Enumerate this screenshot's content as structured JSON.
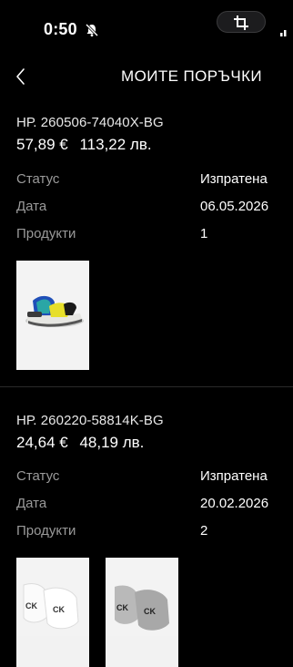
{
  "status_bar": {
    "time": "0:50"
  },
  "header": {
    "title": "МОИТЕ ПОРЪЧКИ"
  },
  "orders": [
    {
      "number": "НР. 260506-74040X-BG",
      "price_eur": "57,89 €",
      "price_bgn": "113,22 лв.",
      "status_label": "Статус",
      "status_value": "Изпратена",
      "date_label": "Дата",
      "date_value": "06.05.2026",
      "products_label": "Продукти",
      "products_value": "1"
    },
    {
      "number": "НР. 260220-58814K-BG",
      "price_eur": "24,64 €",
      "price_bgn": "48,19 лв.",
      "status_label": "Статус",
      "status_value": "Изпратена",
      "date_label": "Дата",
      "date_value": "20.02.2026",
      "products_label": "Продукти",
      "products_value": "2"
    }
  ],
  "icons": {
    "back": "chevron-left-icon",
    "mute": "bell-slash-icon",
    "crop": "crop-icon"
  }
}
